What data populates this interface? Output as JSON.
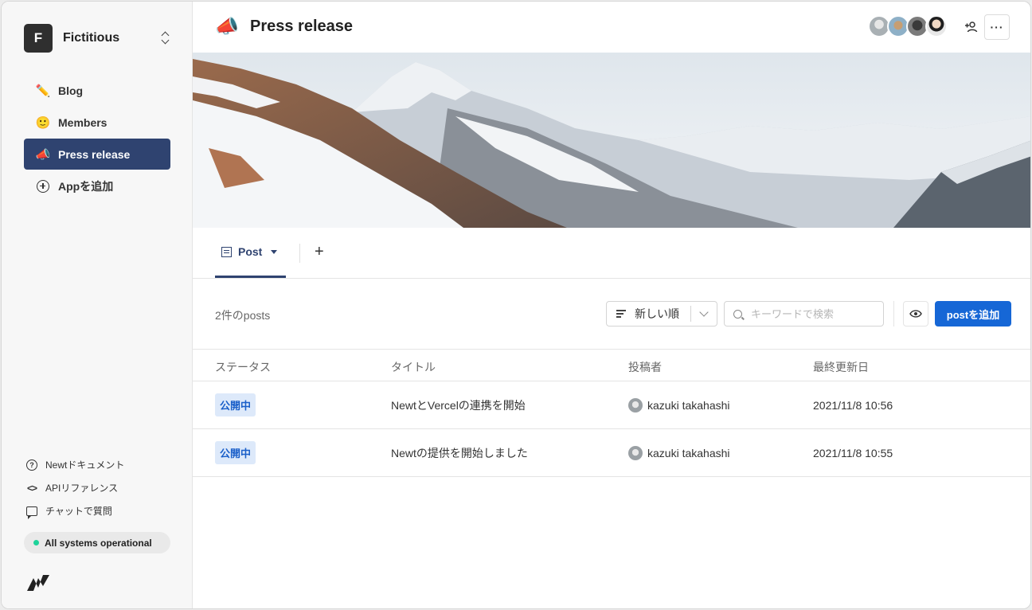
{
  "workspace": {
    "initial": "F",
    "name": "Fictitious"
  },
  "sidebar": {
    "items": [
      {
        "emoji": "✏️",
        "label": "Blog"
      },
      {
        "emoji": "🙂",
        "label": "Members"
      },
      {
        "emoji": "📣",
        "label": "Press release"
      },
      {
        "label": "Appを追加"
      }
    ],
    "links": [
      {
        "label": "Newtドキュメント"
      },
      {
        "label": "APIリファレンス"
      },
      {
        "label": "チャットで質問"
      }
    ],
    "status": "All systems operational"
  },
  "header": {
    "icon": "📣",
    "title": "Press release",
    "more": "···"
  },
  "tabs": {
    "post_label": "Post",
    "add": "+"
  },
  "toolbar": {
    "count": "2件のposts",
    "sort_label": "新しい順",
    "search_placeholder": "キーワードで検索",
    "add_label": "postを追加"
  },
  "table": {
    "headers": [
      "ステータス",
      "タイトル",
      "投稿者",
      "最終更新日"
    ],
    "rows": [
      {
        "status": "公開中",
        "title": "NewtとVercelの連携を開始",
        "author": "kazuki takahashi",
        "updated": "2021/11/8 10:56"
      },
      {
        "status": "公開中",
        "title": "Newtの提供を開始しました",
        "author": "kazuki takahashi",
        "updated": "2021/11/8 10:55"
      }
    ]
  },
  "colors": {
    "accent": "#2f4370",
    "primary_button": "#1667d6",
    "badge_bg": "#dde9fa",
    "status_dot": "#1ed39a"
  }
}
